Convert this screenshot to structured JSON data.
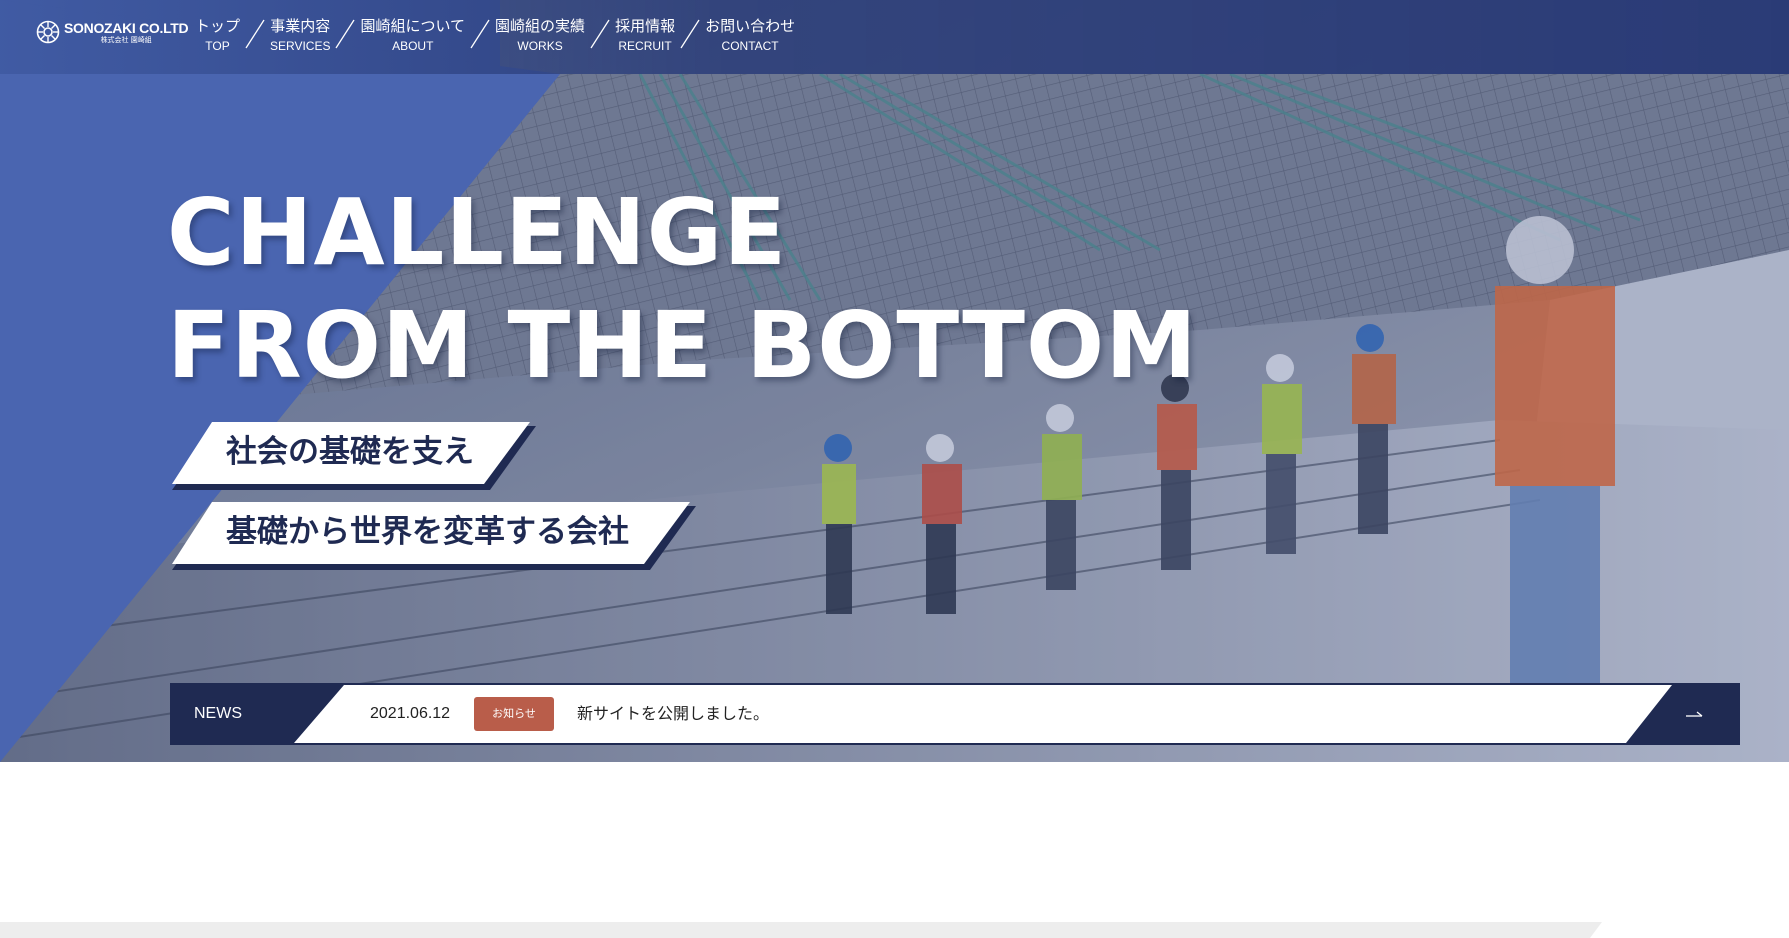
{
  "brand": {
    "name": "SONOZAKI CO.LTD",
    "sub": "株式会社 園崎組"
  },
  "nav": {
    "items": [
      {
        "jp": "トップ",
        "en": "TOP"
      },
      {
        "jp": "事業内容",
        "en": "SERVICES"
      },
      {
        "jp": "園崎組について",
        "en": "ABOUT"
      },
      {
        "jp": "園崎組の実績",
        "en": "WORKS"
      },
      {
        "jp": "採用情報",
        "en": "RECRUIT"
      },
      {
        "jp": "お問い合わせ",
        "en": "CONTACT"
      }
    ]
  },
  "hero": {
    "headline_line1": "CHALLENGE",
    "headline_line2": "FROM THE BOTTOM",
    "tagline1": "社会の基礎を支え",
    "tagline2": "基礎から世界を変革する会社"
  },
  "news": {
    "label": "NEWS",
    "date": "2021.06.12",
    "category": "お知らせ",
    "title": "新サイトを公開しました。",
    "more_icon": "arrow-right-icon"
  },
  "colors": {
    "navy": "#1f2a52",
    "blue": "#4a65b0",
    "badge": "#b95d4a",
    "white": "#ffffff"
  }
}
